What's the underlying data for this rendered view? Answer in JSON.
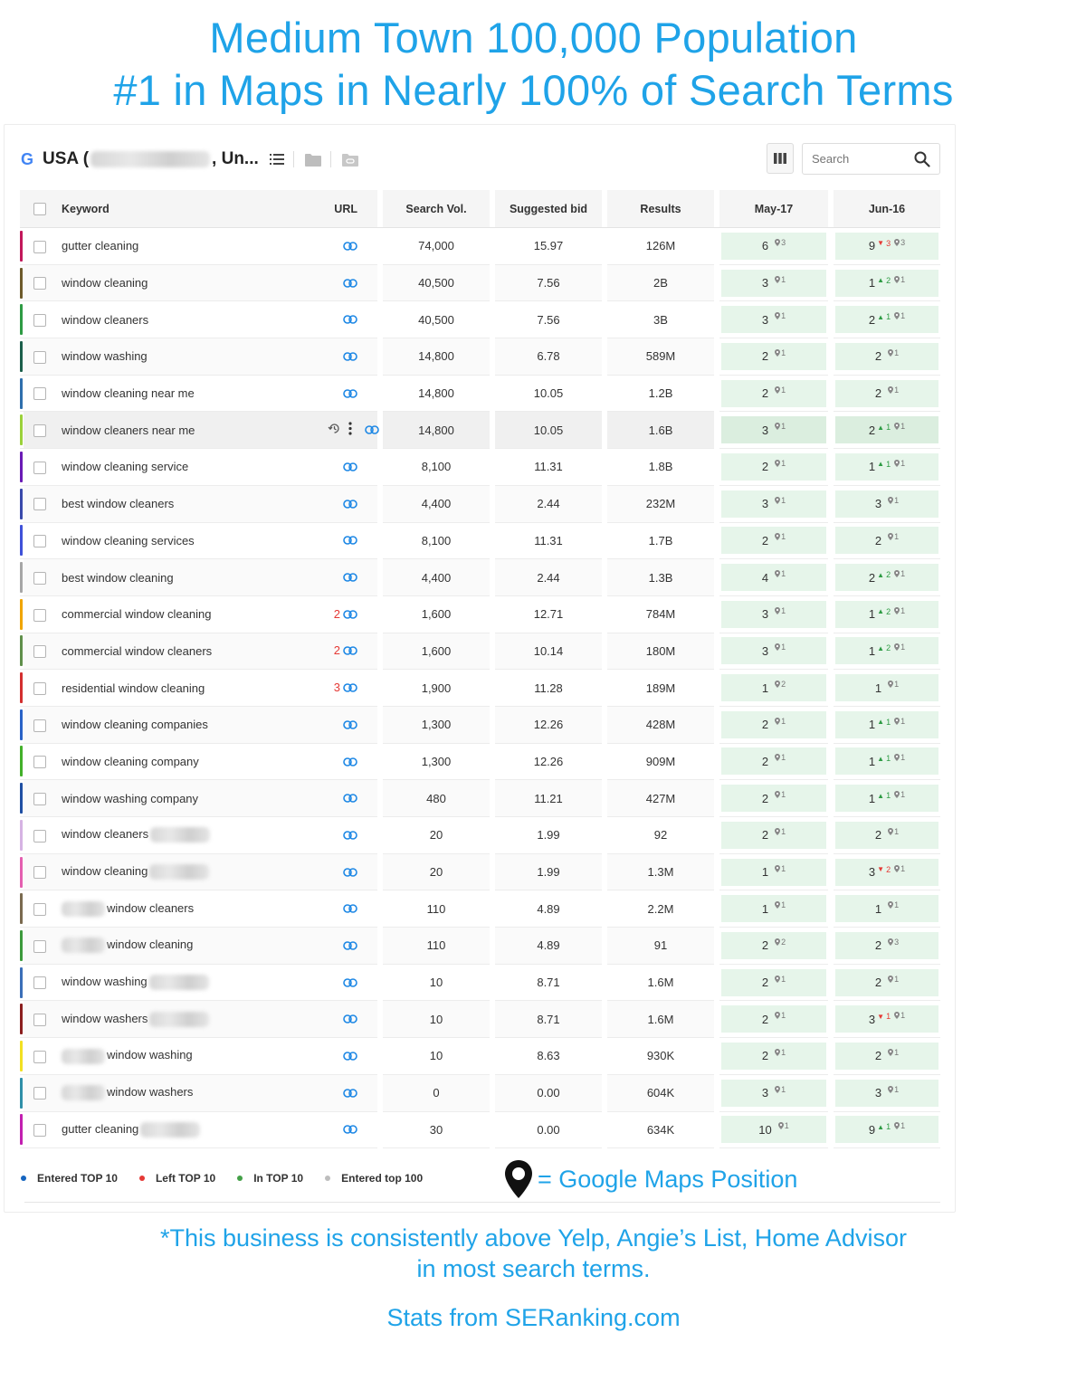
{
  "headline": {
    "line1": "Medium Town 100,000 Population",
    "line2": "#1 in Maps in Nearly 100% of Search Terms"
  },
  "toolbar": {
    "engine_icon": "google-g-icon",
    "engine_letter": "G",
    "project_prefix": "USA (",
    "project_suffix": ", Un...",
    "search_placeholder": "Search"
  },
  "table": {
    "headers": {
      "keyword": "Keyword",
      "url": "URL",
      "search_vol": "Search Vol.",
      "suggested_bid": "Suggested bid",
      "results": "Results",
      "date1": "May-17",
      "date2": "Jun-16"
    },
    "rows": [
      {
        "color": "#c2185b",
        "keyword": "gutter cleaning",
        "blur": "none",
        "url_num": "",
        "vol": "74,000",
        "bid": "15.97",
        "results": "126M",
        "may": "6",
        "may_pin": "3",
        "jun": "9",
        "jun_dir": "down",
        "jun_delta": "3",
        "jun_pin": "3"
      },
      {
        "color": "#6d5a2b",
        "keyword": "window cleaning",
        "blur": "none",
        "url_num": "",
        "vol": "40,500",
        "bid": "7.56",
        "results": "2B",
        "may": "3",
        "may_pin": "1",
        "jun": "1",
        "jun_dir": "up",
        "jun_delta": "2",
        "jun_pin": "1"
      },
      {
        "color": "#2e9b44",
        "keyword": "window cleaners",
        "blur": "none",
        "url_num": "",
        "vol": "40,500",
        "bid": "7.56",
        "results": "3B",
        "may": "3",
        "may_pin": "1",
        "jun": "2",
        "jun_dir": "up",
        "jun_delta": "1",
        "jun_pin": "1"
      },
      {
        "color": "#1b5e4a",
        "keyword": "window washing",
        "blur": "none",
        "url_num": "",
        "vol": "14,800",
        "bid": "6.78",
        "results": "589M",
        "may": "2",
        "may_pin": "1",
        "jun": "2",
        "jun_dir": "",
        "jun_delta": "",
        "jun_pin": "1"
      },
      {
        "color": "#2f6fad",
        "keyword": "window cleaning near me",
        "blur": "none",
        "url_num": "",
        "vol": "14,800",
        "bid": "10.05",
        "results": "1.2B",
        "may": "2",
        "may_pin": "1",
        "jun": "2",
        "jun_dir": "",
        "jun_delta": "",
        "jun_pin": "1"
      },
      {
        "color": "#9bd13b",
        "keyword": "window cleaners near me",
        "blur": "none",
        "url_num": "",
        "vol": "14,800",
        "bid": "10.05",
        "results": "1.6B",
        "may": "3",
        "may_pin": "1",
        "jun": "2",
        "jun_dir": "up",
        "jun_delta": "1",
        "jun_pin": "1",
        "highlight": true
      },
      {
        "color": "#6a1bb5",
        "keyword": "window cleaning service",
        "blur": "none",
        "url_num": "",
        "vol": "8,100",
        "bid": "11.31",
        "results": "1.8B",
        "may": "2",
        "may_pin": "1",
        "jun": "1",
        "jun_dir": "up",
        "jun_delta": "1",
        "jun_pin": "1"
      },
      {
        "color": "#3949ab",
        "keyword": "best window cleaners",
        "blur": "none",
        "url_num": "",
        "vol": "4,400",
        "bid": "2.44",
        "results": "232M",
        "may": "3",
        "may_pin": "1",
        "jun": "3",
        "jun_dir": "",
        "jun_delta": "",
        "jun_pin": "1"
      },
      {
        "color": "#3f51d9",
        "keyword": "window cleaning services",
        "blur": "none",
        "url_num": "",
        "vol": "8,100",
        "bid": "11.31",
        "results": "1.7B",
        "may": "2",
        "may_pin": "1",
        "jun": "2",
        "jun_dir": "",
        "jun_delta": "",
        "jun_pin": "1"
      },
      {
        "color": "#a6a6a6",
        "keyword": "best window cleaning",
        "blur": "none",
        "url_num": "",
        "vol": "4,400",
        "bid": "2.44",
        "results": "1.3B",
        "may": "4",
        "may_pin": "1",
        "jun": "2",
        "jun_dir": "up",
        "jun_delta": "2",
        "jun_pin": "1"
      },
      {
        "color": "#f0a500",
        "keyword": "commercial window cleaning",
        "blur": "none",
        "url_num": "2",
        "vol": "1,600",
        "bid": "12.71",
        "results": "784M",
        "may": "3",
        "may_pin": "1",
        "jun": "1",
        "jun_dir": "up",
        "jun_delta": "2",
        "jun_pin": "1"
      },
      {
        "color": "#5f8f4a",
        "keyword": "commercial window cleaners",
        "blur": "none",
        "url_num": "2",
        "vol": "1,600",
        "bid": "10.14",
        "results": "180M",
        "may": "3",
        "may_pin": "1",
        "jun": "1",
        "jun_dir": "up",
        "jun_delta": "2",
        "jun_pin": "1"
      },
      {
        "color": "#d32f2f",
        "keyword": "residential window cleaning",
        "blur": "none",
        "url_num": "3",
        "vol": "1,900",
        "bid": "11.28",
        "results": "189M",
        "may": "1",
        "may_pin": "2",
        "jun": "1",
        "jun_dir": "",
        "jun_delta": "",
        "jun_pin": "1"
      },
      {
        "color": "#2962c7",
        "keyword": "window cleaning companies",
        "blur": "none",
        "url_num": "",
        "vol": "1,300",
        "bid": "12.26",
        "results": "428M",
        "may": "2",
        "may_pin": "1",
        "jun": "1",
        "jun_dir": "up",
        "jun_delta": "1",
        "jun_pin": "1"
      },
      {
        "color": "#43b02a",
        "keyword": "window cleaning company",
        "blur": "none",
        "url_num": "",
        "vol": "1,300",
        "bid": "12.26",
        "results": "909M",
        "may": "2",
        "may_pin": "1",
        "jun": "1",
        "jun_dir": "up",
        "jun_delta": "1",
        "jun_pin": "1"
      },
      {
        "color": "#1f4fa3",
        "keyword": "window washing company",
        "blur": "none",
        "url_num": "",
        "vol": "480",
        "bid": "11.21",
        "results": "427M",
        "may": "2",
        "may_pin": "1",
        "jun": "1",
        "jun_dir": "up",
        "jun_delta": "1",
        "jun_pin": "1"
      },
      {
        "color": "#d6b3e3",
        "keyword": "window cleaners",
        "blur": "after",
        "url_num": "",
        "vol": "20",
        "bid": "1.99",
        "results": "92",
        "may": "2",
        "may_pin": "1",
        "jun": "2",
        "jun_dir": "",
        "jun_delta": "",
        "jun_pin": "1"
      },
      {
        "color": "#e45fb0",
        "keyword": "window cleaning",
        "blur": "after",
        "url_num": "",
        "vol": "20",
        "bid": "1.99",
        "results": "1.3M",
        "may": "1",
        "may_pin": "1",
        "jun": "3",
        "jun_dir": "down",
        "jun_delta": "2",
        "jun_pin": "1"
      },
      {
        "color": "#7a6a4f",
        "keyword": "window cleaners",
        "blur": "before",
        "url_num": "",
        "vol": "110",
        "bid": "4.89",
        "results": "2.2M",
        "may": "1",
        "may_pin": "1",
        "jun": "1",
        "jun_dir": "",
        "jun_delta": "",
        "jun_pin": "1"
      },
      {
        "color": "#3c9a3c",
        "keyword": "window cleaning",
        "blur": "before",
        "url_num": "",
        "vol": "110",
        "bid": "4.89",
        "results": "91",
        "may": "2",
        "may_pin": "2",
        "jun": "2",
        "jun_dir": "",
        "jun_delta": "",
        "jun_pin": "3"
      },
      {
        "color": "#3b6fb8",
        "keyword": "window washing",
        "blur": "after",
        "url_num": "",
        "vol": "10",
        "bid": "8.71",
        "results": "1.6M",
        "may": "2",
        "may_pin": "1",
        "jun": "2",
        "jun_dir": "",
        "jun_delta": "",
        "jun_pin": "1"
      },
      {
        "color": "#8b1e1e",
        "keyword": "window washers",
        "blur": "after",
        "url_num": "",
        "vol": "10",
        "bid": "8.71",
        "results": "1.6M",
        "may": "2",
        "may_pin": "1",
        "jun": "3",
        "jun_dir": "down",
        "jun_delta": "1",
        "jun_pin": "1"
      },
      {
        "color": "#f2e022",
        "keyword": "window washing",
        "blur": "before",
        "url_num": "",
        "vol": "10",
        "bid": "8.63",
        "results": "930K",
        "may": "2",
        "may_pin": "1",
        "jun": "2",
        "jun_dir": "",
        "jun_delta": "",
        "jun_pin": "1"
      },
      {
        "color": "#2f8fa8",
        "keyword": "window washers",
        "blur": "before",
        "url_num": "",
        "vol": "0",
        "bid": "0.00",
        "results": "604K",
        "may": "3",
        "may_pin": "1",
        "jun": "3",
        "jun_dir": "",
        "jun_delta": "",
        "jun_pin": "1"
      },
      {
        "color": "#c21fb0",
        "keyword": "gutter cleaning",
        "blur": "after",
        "url_num": "",
        "vol": "30",
        "bid": "0.00",
        "results": "634K",
        "may": "10",
        "may_pin": "1",
        "jun": "9",
        "jun_dir": "up",
        "jun_delta": "1",
        "jun_pin": "1"
      }
    ]
  },
  "legend": [
    {
      "label": "Entered TOP 10",
      "color": "#1565c0"
    },
    {
      "label": "Left TOP 10",
      "color": "#e53935"
    },
    {
      "label": "In TOP 10",
      "color": "#43a047"
    },
    {
      "label": "Entered top 100",
      "color": "#bdbdbd"
    }
  ],
  "maps_note": "= Google Maps Position",
  "note": {
    "line1": "*This business is consistently above Yelp, Angie’s List, Home Advisor",
    "line2": "in most search terms.",
    "source": "Stats from SERanking.com"
  }
}
